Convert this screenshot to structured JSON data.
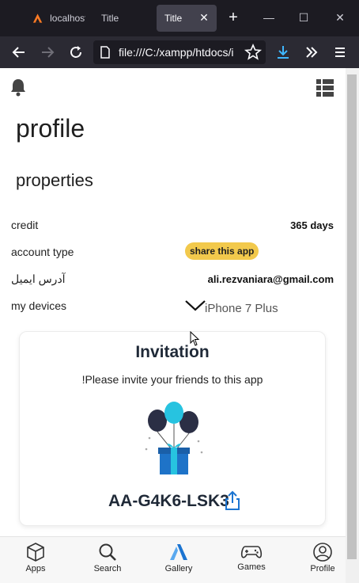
{
  "browser": {
    "tabs": [
      {
        "label": "localhost"
      },
      {
        "label": "Title"
      },
      {
        "label": "Title",
        "active": true
      }
    ],
    "url": "file:///C:/xampp/htdocs/i",
    "close_glyph": "✕",
    "new_tab_glyph": "+",
    "window_controls": [
      "—",
      "☐",
      "✕"
    ]
  },
  "page": {
    "title": "profile",
    "section_title": "properties",
    "rows": [
      {
        "label": "credit",
        "value": "365 days"
      },
      {
        "label": "account type",
        "badge": "share this app"
      },
      {
        "label": "آدرس ایمیل",
        "value": "ali.rezvaniara@gmail.com"
      },
      {
        "label": "my devices",
        "device": "iPhone 7 Plus"
      }
    ],
    "invitation": {
      "title": "Invitation",
      "text": "!Please invite your friends to this app",
      "code": "AA-G4K6-LSK3"
    }
  },
  "bottom_nav": {
    "items": [
      {
        "label": "Apps",
        "icon": "cube-icon"
      },
      {
        "label": "Search",
        "icon": "magnifier-icon"
      },
      {
        "label": "Gallery",
        "icon": "gallery-icon",
        "active": true
      },
      {
        "label": "Games",
        "icon": "gamepad-icon"
      },
      {
        "label": "Profile",
        "icon": "user-circle-icon"
      }
    ]
  },
  "colors": {
    "badge": "#f2c94c",
    "accent": "#1b74d1",
    "chrome_dark": "#1c1b22",
    "chrome_toolbar": "#2b2a33"
  }
}
